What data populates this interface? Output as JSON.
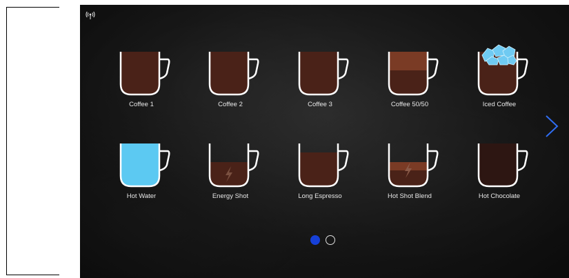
{
  "drinks": [
    {
      "label": "Coffee 1"
    },
    {
      "label": "Coffee 2"
    },
    {
      "label": "Coffee 3"
    },
    {
      "label": "Coffee 50/50"
    },
    {
      "label": "Iced Coffee"
    },
    {
      "label": "Hot Water"
    },
    {
      "label": "Energy Shot"
    },
    {
      "label": "Long Espresso"
    },
    {
      "label": "Hot Shot Blend"
    },
    {
      "label": "Hot Chocolate"
    }
  ],
  "colors": {
    "coffee": "#4a2218",
    "coffee_top": "#7a3b25",
    "water": "#5cc9f2",
    "cup_outline": "#ffffff",
    "accent": "#1640d8"
  },
  "icons": {
    "wifi": "wifi-icon",
    "next": "chevron-right-icon",
    "energy": "lightning-icon",
    "ice": "ice-cubes-icon"
  },
  "pagination": {
    "current_page": 1,
    "total_pages": 2
  }
}
